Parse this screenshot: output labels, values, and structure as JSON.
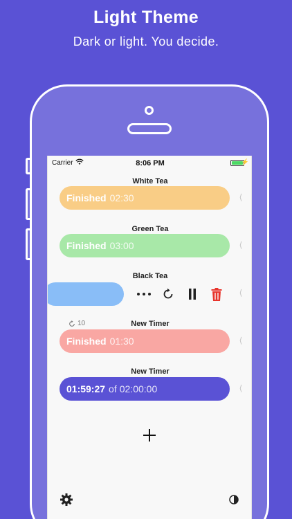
{
  "promo": {
    "headline": "Light Theme",
    "subline": "Dark or light. You decide."
  },
  "status_bar": {
    "carrier": "Carrier",
    "time": "8:06 PM"
  },
  "timers": [
    {
      "title": "White Tea",
      "status": "Finished",
      "time": "02:30",
      "color": "#f9cd86"
    },
    {
      "title": "Green Tea",
      "status": "Finished",
      "time": "03:00",
      "color": "#a8e8a8"
    },
    {
      "title": "Black Tea",
      "color": "#89bdf7"
    },
    {
      "title": "New Timer",
      "status": "Finished",
      "time": "01:30",
      "color": "#f9a7a3",
      "repeat_count": "10"
    },
    {
      "title": "New Timer",
      "remaining": "01:59:27",
      "of_label": "of",
      "total": "02:00:00",
      "color": "#5a52d5"
    }
  ],
  "chevron_glyph": "⟨",
  "colors": {
    "background": "#5a52d5",
    "screen": "#f8f8f8",
    "delete": "#e8342c",
    "accent": "#5a52d5"
  },
  "icons": [
    "wifi-icon",
    "battery-icon",
    "more-icon",
    "reset-icon",
    "pause-icon",
    "trash-icon",
    "repeat-icon",
    "add-icon",
    "gear-icon",
    "contrast-icon",
    "chevron-left-icon"
  ]
}
